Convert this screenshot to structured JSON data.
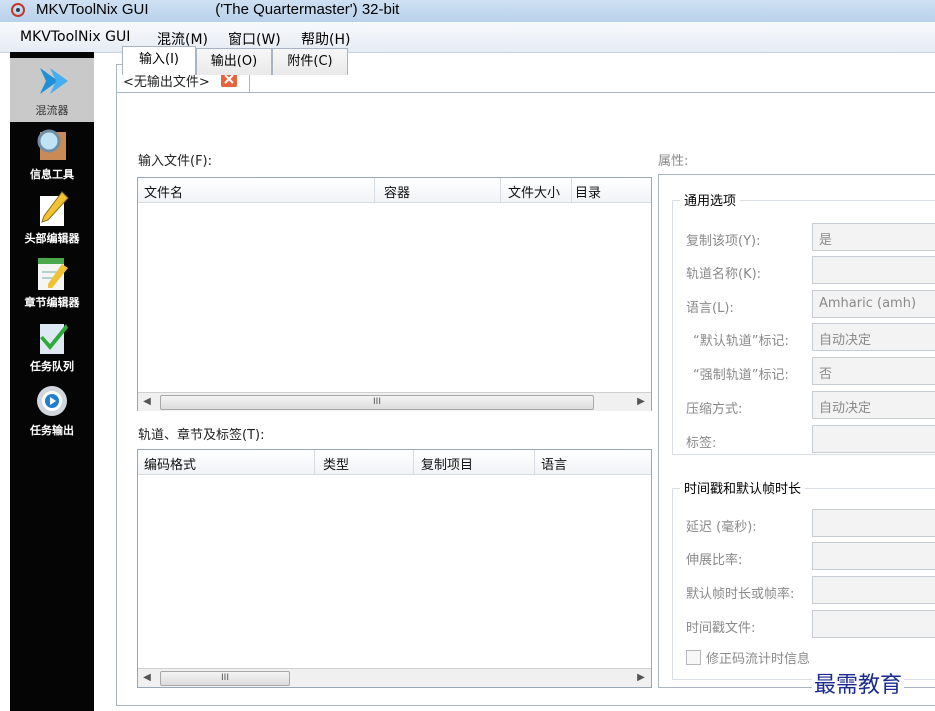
{
  "window": {
    "title_prefix": "MKVToolNix GUI",
    "title_suffix": "('The Quartermaster') 32-bit",
    "app_icon": "mkvtoolnix-icon"
  },
  "menu": [
    "MKVToolNix GUI",
    "混流(M)",
    "窗口(W)",
    "帮助(H)"
  ],
  "sidebar": {
    "items": [
      {
        "label": "混流器",
        "icon": "chevron-right-icon",
        "active": true
      },
      {
        "label": "信息工具",
        "icon": "magnifier-icon",
        "active": false
      },
      {
        "label": "头部编辑器",
        "icon": "pencil-icon",
        "active": false
      },
      {
        "label": "章节编辑器",
        "icon": "notepad-icon",
        "active": false
      },
      {
        "label": "任务队列",
        "icon": "checkmark-icon",
        "active": false
      },
      {
        "label": "任务输出",
        "icon": "gear-icon",
        "active": false
      }
    ]
  },
  "document_tab": {
    "label": "<无输出文件>",
    "close_icon": "close-icon"
  },
  "inner_tabs": [
    "输入(I)",
    "输出(O)",
    "附件(C)"
  ],
  "input_files": {
    "label": "输入文件(F):",
    "columns": [
      "文件名",
      "容器",
      "文件大小",
      "目录"
    ]
  },
  "tracks": {
    "label": "轨道、章节及标签(T):",
    "columns": [
      "编码格式",
      "类型",
      "复制项目",
      "语言"
    ]
  },
  "properties": {
    "label": "属性:",
    "general_title": "通用选项",
    "general_fields": [
      {
        "label": "复制该项(Y):",
        "value": "是"
      },
      {
        "label": "轨道名称(K):",
        "value": ""
      },
      {
        "label": "语言(L):",
        "value": "Amharic (amh)"
      },
      {
        "label": "“默认轨道”标记:",
        "value": "自动决定"
      },
      {
        "label": "“强制轨道”标记:",
        "value": "否"
      },
      {
        "label": "压缩方式:",
        "value": "自动决定"
      },
      {
        "label": "标签:",
        "value": ""
      }
    ],
    "timing_title": "时间戳和默认帧时长",
    "timing_fields": [
      {
        "label": "延迟 (毫秒):",
        "value": ""
      },
      {
        "label": "伸展比率:",
        "value": ""
      },
      {
        "label": "默认帧时长或帧率:",
        "value": ""
      },
      {
        "label": "时间戳文件:",
        "value": ""
      }
    ],
    "fix_bitstream_label": "修正码流计时信息"
  },
  "watermark": "最需教育",
  "colors": {
    "sidebar_bg": "#050505",
    "close_tab": "#e8623d",
    "watermark": "#1b2b8f"
  }
}
